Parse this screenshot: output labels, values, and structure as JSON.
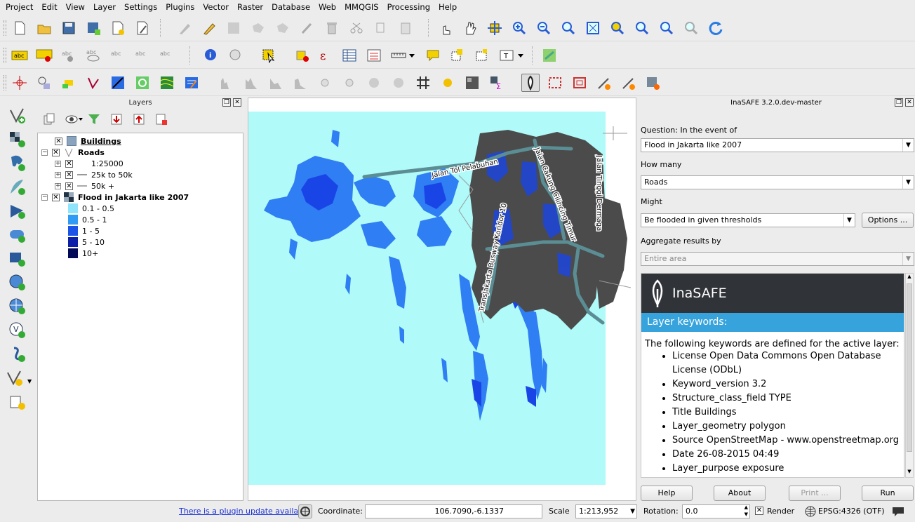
{
  "menu": [
    "Project",
    "Edit",
    "View",
    "Layer",
    "Settings",
    "Plugins",
    "Vector",
    "Raster",
    "Database",
    "Web",
    "MMQGIS",
    "Processing",
    "Help"
  ],
  "layers_panel": {
    "title": "Layers",
    "tree": [
      {
        "label": "Buildings",
        "kind": "layer",
        "checked": true,
        "bold": true,
        "underline": true
      },
      {
        "label": "Roads",
        "kind": "group",
        "checked": true
      },
      {
        "label": "1:25000",
        "kind": "sub",
        "checked": true
      },
      {
        "label": "25k to 50k",
        "kind": "sub",
        "checked": true
      },
      {
        "label": "50k +",
        "kind": "sub",
        "checked": true
      },
      {
        "label": "Flood in Jakarta like 2007",
        "kind": "group",
        "checked": true
      },
      {
        "label": "0.1 - 0.5",
        "kind": "legend",
        "color": "#8ee4fb"
      },
      {
        "label": "0.5 - 1",
        "kind": "legend",
        "color": "#2f9bf5"
      },
      {
        "label": "1 - 5",
        "kind": "legend",
        "color": "#1a53e6"
      },
      {
        "label": "5 - 10",
        "kind": "legend",
        "color": "#0b1fa8"
      },
      {
        "label": "10+",
        "kind": "legend",
        "color": "#020a58"
      }
    ]
  },
  "map": {
    "road_labels": [
      "Jalan Tol Pelabuhan",
      "Jalan Cakung Cilincing Timur",
      "Jalan Tinggi Dermaga",
      "TransJakarta Busway Koridor 10"
    ],
    "colors": {
      "background": "#b0fafa",
      "flood_light": "#3a8cf0",
      "flood_dark": "#1238e0",
      "buildings": "#4b4b4b",
      "roads": "#5b8e94"
    }
  },
  "inasafe": {
    "title": "InaSAFE 3.2.0.dev-master",
    "question_label": "Question: In the event of",
    "hazard_value": "Flood in Jakarta like 2007",
    "how_many_label": "How many",
    "exposure_value": "Roads",
    "might_label": "Might",
    "function_value": "Be flooded in given thresholds",
    "options_button": "Options ...",
    "aggregate_label": "Aggregate results by",
    "aggregate_value": "Entire area",
    "report": {
      "logo_text": "InaSAFE",
      "section_title": "Layer keywords:",
      "intro": "The following keywords are defined for the active layer:",
      "items": [
        "License Open Data Commons Open Database License (ODbL)",
        "Keyword_version 3.2",
        "Structure_class_field TYPE",
        "Title Buildings",
        "Layer_geometry polygon",
        "Source OpenStreetMap - www.openstreetmap.org",
        "Date 26-08-2015 04:49",
        "Layer_purpose exposure"
      ]
    },
    "buttons": {
      "help": "Help",
      "about": "About",
      "print": "Print ...",
      "run": "Run"
    }
  },
  "statusbar": {
    "plugin_update": "There is a plugin update available",
    "coordinate_label": "Coordinate:",
    "coordinate_value": "106.7090,-6.1337",
    "scale_label": "Scale",
    "scale_value": "1:213,952",
    "rotation_label": "Rotation:",
    "rotation_value": "0.0",
    "render_label": "Render",
    "crs": "EPSG:4326 (OTF)"
  }
}
